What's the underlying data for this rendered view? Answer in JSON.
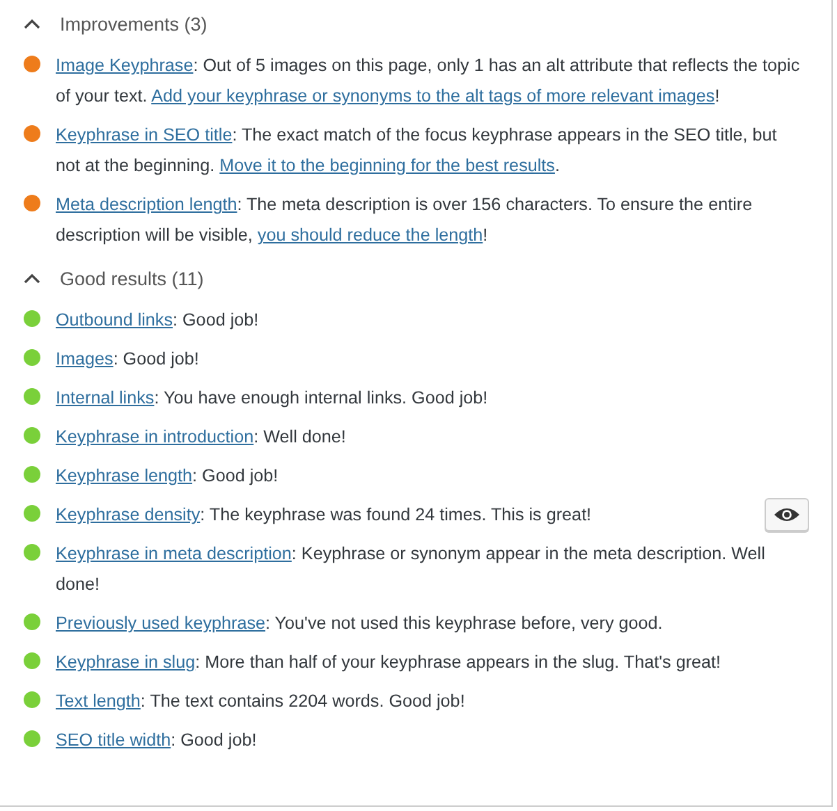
{
  "sections": [
    {
      "title": "Improvements (3)",
      "expanded": true,
      "items": [
        {
          "color": "#ee7c1b",
          "marker_button": false,
          "parts": [
            {
              "kind": "link",
              "text": "Image Keyphrase"
            },
            {
              "kind": "text",
              "text": ": Out of 5 images on this page, only 1 has an alt attribute that reflects the topic of your text. "
            },
            {
              "kind": "link",
              "text": "Add your keyphrase or synonyms to the alt tags of more relevant images"
            },
            {
              "kind": "text",
              "text": "!"
            }
          ]
        },
        {
          "color": "#ee7c1b",
          "marker_button": false,
          "parts": [
            {
              "kind": "link",
              "text": "Keyphrase in SEO title"
            },
            {
              "kind": "text",
              "text": ": The exact match of the focus keyphrase appears in the SEO title, but not at the beginning. "
            },
            {
              "kind": "link",
              "text": "Move it to the beginning for the best results"
            },
            {
              "kind": "text",
              "text": "."
            }
          ]
        },
        {
          "color": "#ee7c1b",
          "marker_button": false,
          "parts": [
            {
              "kind": "link",
              "text": "Meta description length"
            },
            {
              "kind": "text",
              "text": ": The meta description is over 156 characters. To ensure the entire description will be visible, "
            },
            {
              "kind": "link",
              "text": "you should reduce the length"
            },
            {
              "kind": "text",
              "text": "!"
            }
          ]
        }
      ]
    },
    {
      "title": "Good results (11)",
      "expanded": true,
      "items": [
        {
          "color": "#7ad03a",
          "marker_button": false,
          "parts": [
            {
              "kind": "link",
              "text": "Outbound links"
            },
            {
              "kind": "text",
              "text": ": Good job!"
            }
          ]
        },
        {
          "color": "#7ad03a",
          "marker_button": false,
          "parts": [
            {
              "kind": "link",
              "text": "Images"
            },
            {
              "kind": "text",
              "text": ": Good job!"
            }
          ]
        },
        {
          "color": "#7ad03a",
          "marker_button": false,
          "parts": [
            {
              "kind": "link",
              "text": "Internal links"
            },
            {
              "kind": "text",
              "text": ": You have enough internal links. Good job!"
            }
          ]
        },
        {
          "color": "#7ad03a",
          "marker_button": false,
          "parts": [
            {
              "kind": "link",
              "text": "Keyphrase in introduction"
            },
            {
              "kind": "text",
              "text": ": Well done!"
            }
          ]
        },
        {
          "color": "#7ad03a",
          "marker_button": false,
          "parts": [
            {
              "kind": "link",
              "text": "Keyphrase length"
            },
            {
              "kind": "text",
              "text": ": Good job!"
            }
          ]
        },
        {
          "color": "#7ad03a",
          "marker_button": true,
          "parts": [
            {
              "kind": "link",
              "text": "Keyphrase density"
            },
            {
              "kind": "text",
              "text": ": The keyphrase was found 24 times. This is great!"
            }
          ]
        },
        {
          "color": "#7ad03a",
          "marker_button": false,
          "parts": [
            {
              "kind": "link",
              "text": "Keyphrase in meta description"
            },
            {
              "kind": "text",
              "text": ": Keyphrase or synonym appear in the meta description. Well done!"
            }
          ]
        },
        {
          "color": "#7ad03a",
          "marker_button": false,
          "parts": [
            {
              "kind": "link",
              "text": "Previously used keyphrase"
            },
            {
              "kind": "text",
              "text": ": You've not used this keyphrase before, very good."
            }
          ]
        },
        {
          "color": "#7ad03a",
          "marker_button": false,
          "parts": [
            {
              "kind": "link",
              "text": "Keyphrase in slug"
            },
            {
              "kind": "text",
              "text": ": More than half of your keyphrase appears in the slug. That's great!"
            }
          ]
        },
        {
          "color": "#7ad03a",
          "marker_button": false,
          "parts": [
            {
              "kind": "link",
              "text": "Text length"
            },
            {
              "kind": "text",
              "text": ": The text contains 2204 words. Good job!"
            }
          ]
        },
        {
          "color": "#7ad03a",
          "marker_button": false,
          "parts": [
            {
              "kind": "link",
              "text": "SEO title width"
            },
            {
              "kind": "text",
              "text": ": Good job!"
            }
          ]
        }
      ]
    }
  ]
}
